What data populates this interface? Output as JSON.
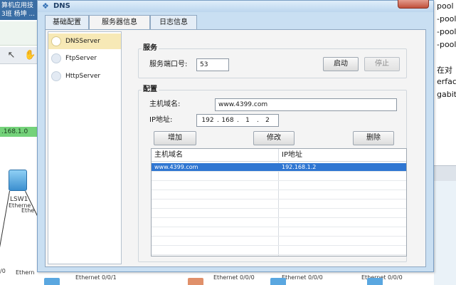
{
  "background_app": {
    "title_lines": [
      "算机应用技",
      "3班 杨坤 ..."
    ],
    "network_label": ".168.1.0",
    "switch_label": "LSW1",
    "port_labels": [
      "Etherne",
      "Ethe",
      "/0",
      "Ethern"
    ],
    "bottom_labels": [
      "Ethernet 0/0/1",
      "Ethernet 0/0/0",
      "Ethernet 0/0/0",
      "Ethernet 0/0/0"
    ],
    "right_lines": [
      "pool",
      "-pool",
      "-pool",
      "-pool",
      "在对",
      "erfac",
      "gabit"
    ]
  },
  "dialog": {
    "title": "DNS",
    "tabs": [
      {
        "label": "基础配置"
      },
      {
        "label": "服务器信息"
      },
      {
        "label": "日志信息"
      }
    ],
    "server_list": [
      {
        "label": "DNSServer"
      },
      {
        "label": "FtpServer"
      },
      {
        "label": "HttpServer"
      }
    ],
    "service": {
      "group_title": "服务",
      "port_label": "服务端口号:",
      "port_value": "53",
      "start_label": "启动",
      "stop_label": "停止"
    },
    "config": {
      "group_title": "配置",
      "host_label": "主机域名:",
      "host_value": "www.4399.com",
      "ip_label": "IP地址:",
      "ip_octets": [
        "192",
        "168",
        "1",
        "2"
      ],
      "add_label": "增加",
      "modify_label": "修改",
      "delete_label": "删除"
    },
    "table": {
      "columns": [
        "主机域名",
        "IP地址"
      ],
      "rows": [
        {
          "host": "www.4399.com",
          "ip": "192.168.1.2"
        }
      ]
    }
  }
}
